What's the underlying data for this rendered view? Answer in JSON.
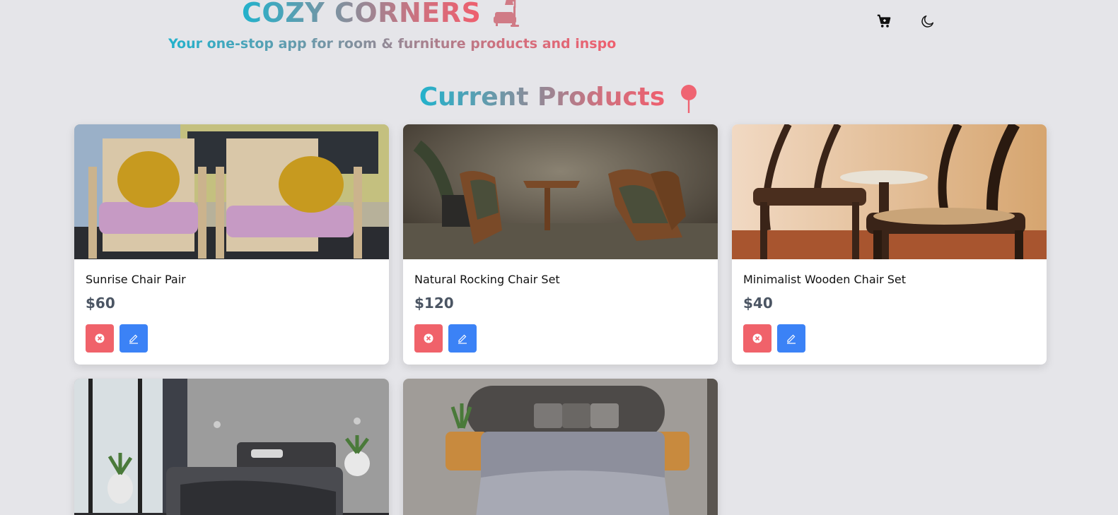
{
  "header": {
    "title": "COZY CORNERS",
    "tagline": "Your one-stop app for room & furniture products and inspo",
    "brand_icon": "floor-lamp-sofa-icon",
    "actions": [
      {
        "name": "cart-icon",
        "label": "cart"
      },
      {
        "name": "moon-icon",
        "label": "dark mode toggle"
      }
    ]
  },
  "section": {
    "title": "Current Products",
    "icon": "pin-icon"
  },
  "products": [
    {
      "name": "Sunrise Chair Pair",
      "price": "$60"
    },
    {
      "name": "Natural Rocking Chair Set",
      "price": "$120"
    },
    {
      "name": "Minimalist Wooden Chair Set",
      "price": "$40"
    },
    {
      "name": "",
      "price": ""
    },
    {
      "name": "",
      "price": ""
    }
  ],
  "colors": {
    "background": "#e5e5e9",
    "gradient_start": "#22b2cc",
    "gradient_end": "#ef5f6e",
    "delete_button": "#f0626a",
    "edit_button": "#3b82f6",
    "price_text": "#4b5563"
  }
}
